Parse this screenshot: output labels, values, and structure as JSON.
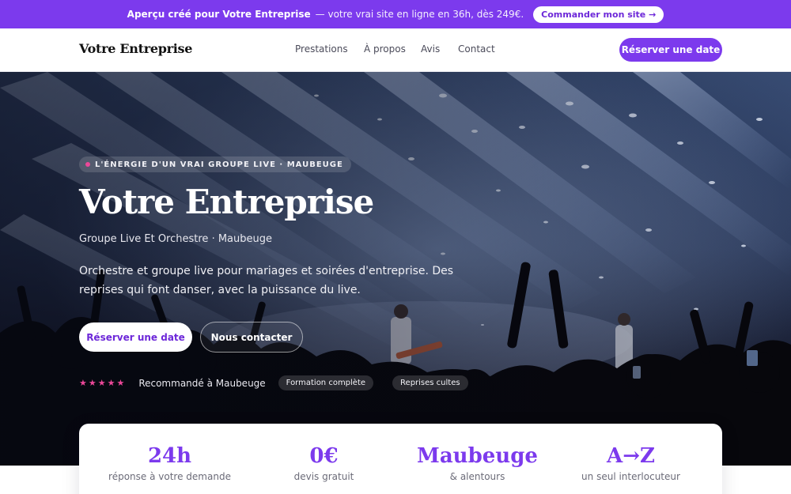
{
  "promo": {
    "strong_text": "Aperçu créé pour Votre Entreprise",
    "rest_text": "— votre vrai site en ligne en 36h, dès 249€.",
    "cta_label": "Commander mon site →"
  },
  "nav": {
    "brand": "Votre Entreprise",
    "links": [
      "Prestations",
      "À propos",
      "Avis",
      "Contact"
    ],
    "book_label": "Réserver une date"
  },
  "hero": {
    "eyebrow": "L'ÉNERGIE D'UN VRAI GROUPE LIVE · MAUBEUGE",
    "title": "Votre Entreprise",
    "subtitle": "Groupe Live Et Orchestre · Maubeuge",
    "lead": "Orchestre et groupe live pour mariages et soirées d'entreprise. Des reprises qui font danser, avec la puissance du live.",
    "primary_button": "Réserver une date",
    "secondary_button": "Nous contacter",
    "stars": "★★★★★",
    "recommendation": "Recommandé à Maubeuge",
    "tags": [
      "Formation complète",
      "Reprises cultes"
    ],
    "background_icon": "concert-photo"
  },
  "stats": [
    {
      "value": "24h",
      "label": "réponse à votre demande"
    },
    {
      "value": "0€",
      "label": "devis gratuit"
    },
    {
      "value": "Maubeuge",
      "label": "& alentours"
    },
    {
      "value": "A→Z",
      "label": "un seul interlocuteur"
    }
  ],
  "colors": {
    "accent": "#7c3aed",
    "star": "#ec4899"
  }
}
